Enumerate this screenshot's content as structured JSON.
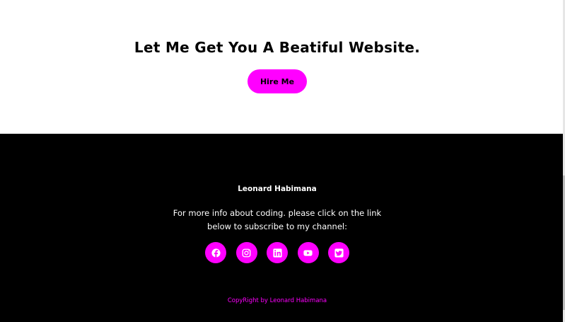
{
  "cta": {
    "title": "Let Me Get You A Beatiful Website.",
    "hire_label": "Hire Me"
  },
  "footer": {
    "name": "Leonard Habimana",
    "text": "For more info about coding. please click on the link below to subscribe to my channel:",
    "social": [
      "facebook-icon",
      "instagram-icon",
      "linkedin-icon",
      "youtube-icon",
      "twitter-icon"
    ],
    "copyright": "CopyRight by Leonard Habimana"
  },
  "colors": {
    "accent": "#ff00ff",
    "footer_bg": "#000000",
    "page_bg": "#ffffff"
  }
}
